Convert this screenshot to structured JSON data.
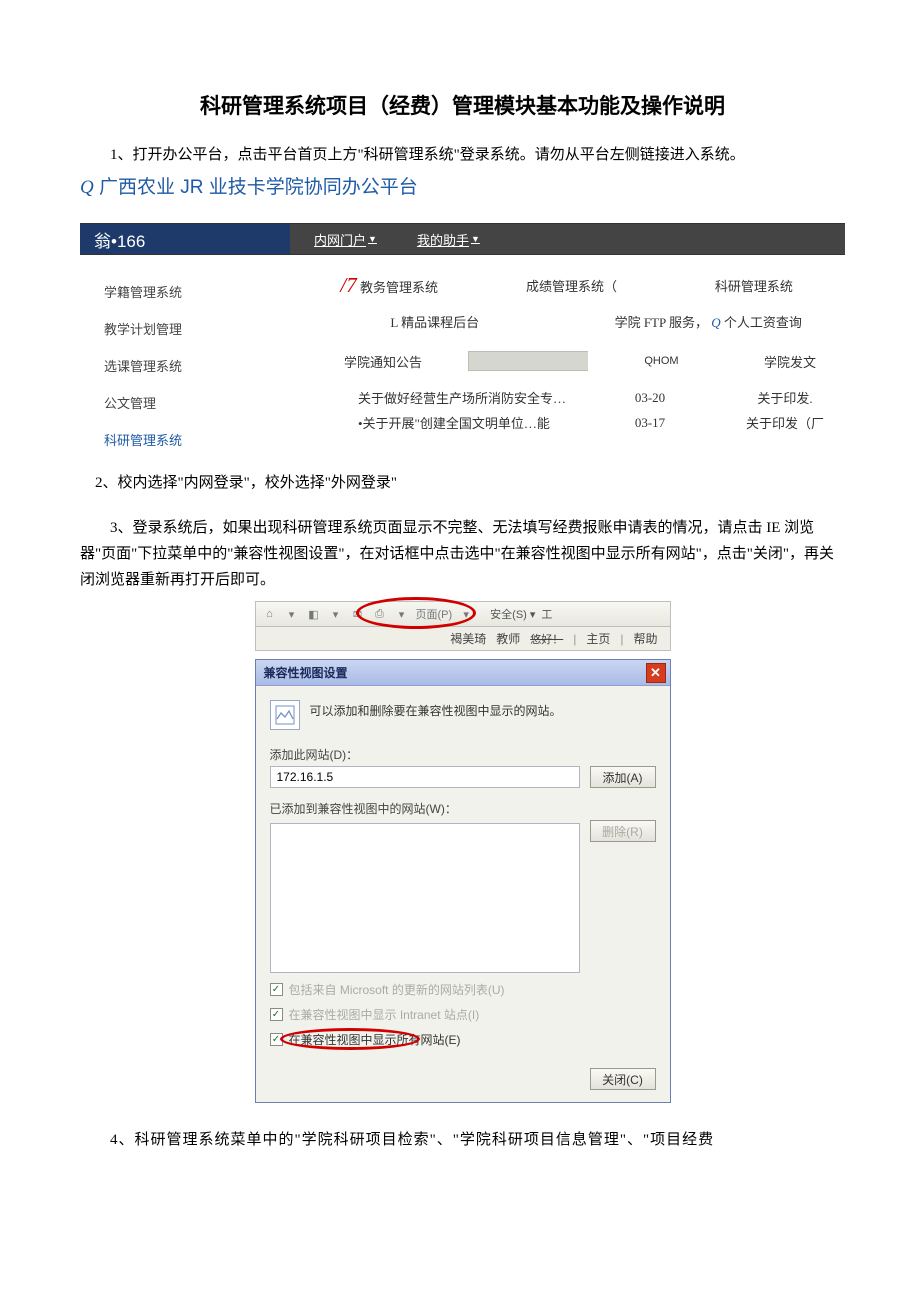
{
  "title": "科研管理系统项目（经费）管理模块基本功能及操作说明",
  "para1": "1、打开办公平台，点击平台首页上方\"科研管理系统\"登录系统。请勿从平台左侧链接进入系统。",
  "platform_line_q": "Q",
  "platform_line": "广西农业 JR 业技卡学院协同办公平台",
  "header": {
    "left": "翁•166",
    "nav1": "内网门户",
    "nav2": "我的助手"
  },
  "sidebar": [
    "学籍管理系统",
    "教学计划管理",
    "选课管理系统",
    "公文管理",
    "科研管理系统"
  ],
  "row1": {
    "slash7_prefix": "/7",
    "c1": "教务管理系统",
    "c2": "成绩管理系统（",
    "c3": "科研管理系统"
  },
  "row2": {
    "c1": "L 精品课程后台",
    "c2": "学院 FTP 服务，",
    "c2q": "Q",
    "c2b": "个人工资查询"
  },
  "row3": {
    "label": "学院通知公告",
    "qhom": "QHOM",
    "fawen": "学院发文"
  },
  "row4": {
    "txt": "关于做好经营生产场所消防安全专…",
    "date": "03-20",
    "rt": "关于印发."
  },
  "row5": {
    "txt": "•关于开展\"创建全国文明单位…能",
    "date": "03-17",
    "rt": "关于印发（厂"
  },
  "para2": "2、校内选择\"内网登录\"，校外选择\"外网登录\"",
  "para3": "3、登录系统后，如果出现科研管理系统页面显示不完整、无法填写经费报账申请表的情况，请点击 IE 浏览器\"页面\"下拉菜单中的\"兼容性视图设置\"，在对话框中点击选中\"在兼容性视图中显示所有网站\"，点击\"关闭\"，再关闭浏览器重新再打开后即可。",
  "ie_toolbar": {
    "safe": "安全(S)",
    "tools_t": "工"
  },
  "subbar": {
    "name": "褐美琦",
    "role": "教师",
    "greet": "悠好！",
    "home": "主页",
    "help": "帮助"
  },
  "dialog": {
    "title": "兼容性视图设置",
    "intro": "可以添加和删除要在兼容性视图中显示的网站。",
    "add_label": "添加此网站(D)：",
    "add_value": "172.16.1.5",
    "add_btn": "添加(A)",
    "added_label": "已添加到兼容性视图中的网站(W)：",
    "del_btn": "删除(R)",
    "chk1": "包括来自 Microsoft 的更新的网站列表(U)",
    "chk2": "在兼容性视图中显示 Intranet 站点(I)",
    "chk3": "在兼容性视图中显示所有网站(E)",
    "close_btn": "关闭(C)"
  },
  "para4": "4、科研管理系统菜单中的\"学院科研项目检索\"、\"学院科研项目信息管理\"、\"项目经费"
}
